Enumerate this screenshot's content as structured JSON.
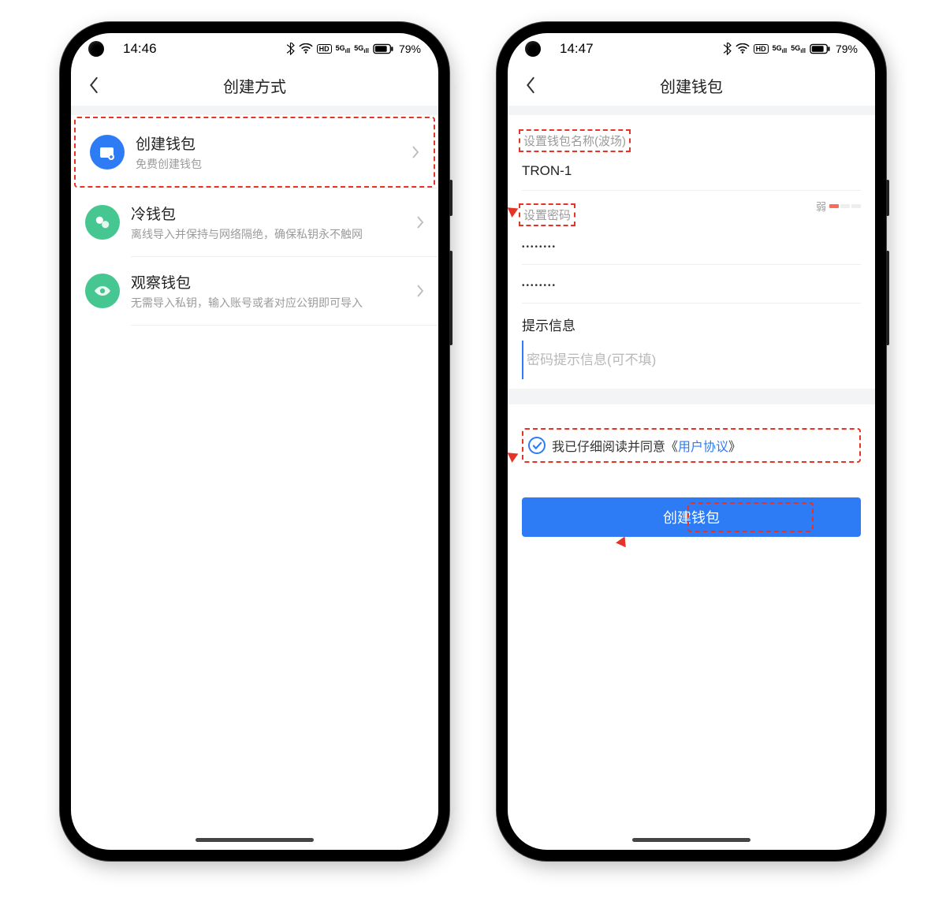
{
  "left": {
    "status": {
      "time": "14:46",
      "battery": "79%"
    },
    "nav_title": "创建方式",
    "items": [
      {
        "title": "创建钱包",
        "sub": "免费创建钱包",
        "icon_bg": "#2e7bf6"
      },
      {
        "title": "冷钱包",
        "sub": "离线导入并保持与网络隔绝，确保私钥永不触网",
        "icon_bg": "#46c690"
      },
      {
        "title": "观察钱包",
        "sub": "无需导入私钥，输入账号或者对应公钥即可导入",
        "icon_bg": "#46c690"
      }
    ]
  },
  "right": {
    "status": {
      "time": "14:47",
      "battery": "79%"
    },
    "nav_title": "创建钱包",
    "name_label": "设置钱包名称(波场)",
    "name_value": "TRON-1",
    "pwd_label": "设置密码",
    "pwd_strength_label": "弱",
    "pwd_value": "••••••••",
    "pwd2_value": "••••••••",
    "hint_label": "提示信息",
    "hint_placeholder": "密码提示信息(可不填)",
    "agree_text": "我已仔细阅读并同意",
    "agree_link_open": "《",
    "agree_link": "用户协议",
    "agree_link_close": "》",
    "button_label": "创建钱包"
  }
}
